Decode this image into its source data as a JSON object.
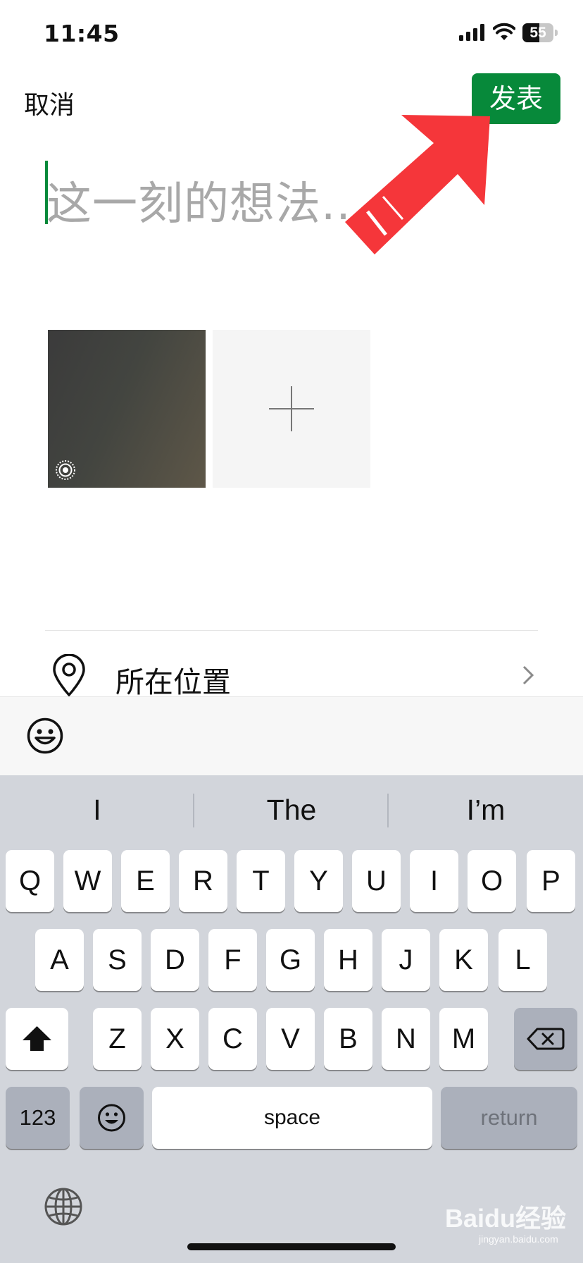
{
  "status_bar": {
    "time": "11:45",
    "battery": "55",
    "battery_level": 0.55
  },
  "header": {
    "cancel_label": "取消",
    "publish_label": "发表"
  },
  "composer": {
    "placeholder": "这一刻的想法..."
  },
  "location": {
    "label": "所在位置"
  },
  "suggestions": [
    "I",
    "The",
    "I’m"
  ],
  "keyboard": {
    "row1": [
      "Q",
      "W",
      "E",
      "R",
      "T",
      "Y",
      "U",
      "I",
      "O",
      "P"
    ],
    "row2": [
      "A",
      "S",
      "D",
      "F",
      "G",
      "H",
      "J",
      "K",
      "L"
    ],
    "row3": [
      "Z",
      "X",
      "C",
      "V",
      "B",
      "N",
      "M"
    ],
    "numbers_label": "123",
    "space_label": "space",
    "return_label": "return"
  },
  "watermark": {
    "brand": "Baidu经验",
    "url": "jingyan.baidu.com"
  },
  "colors": {
    "accent": "#07893a",
    "arrow": "#f5363a",
    "keyboard_bg": "#d2d5db"
  },
  "icons": [
    "signal-icon",
    "wifi-icon",
    "battery-icon",
    "live-photo-icon",
    "plus-icon",
    "location-pin-icon",
    "chevron-right-icon",
    "emoji-icon",
    "shift-icon",
    "delete-icon",
    "globe-icon"
  ]
}
